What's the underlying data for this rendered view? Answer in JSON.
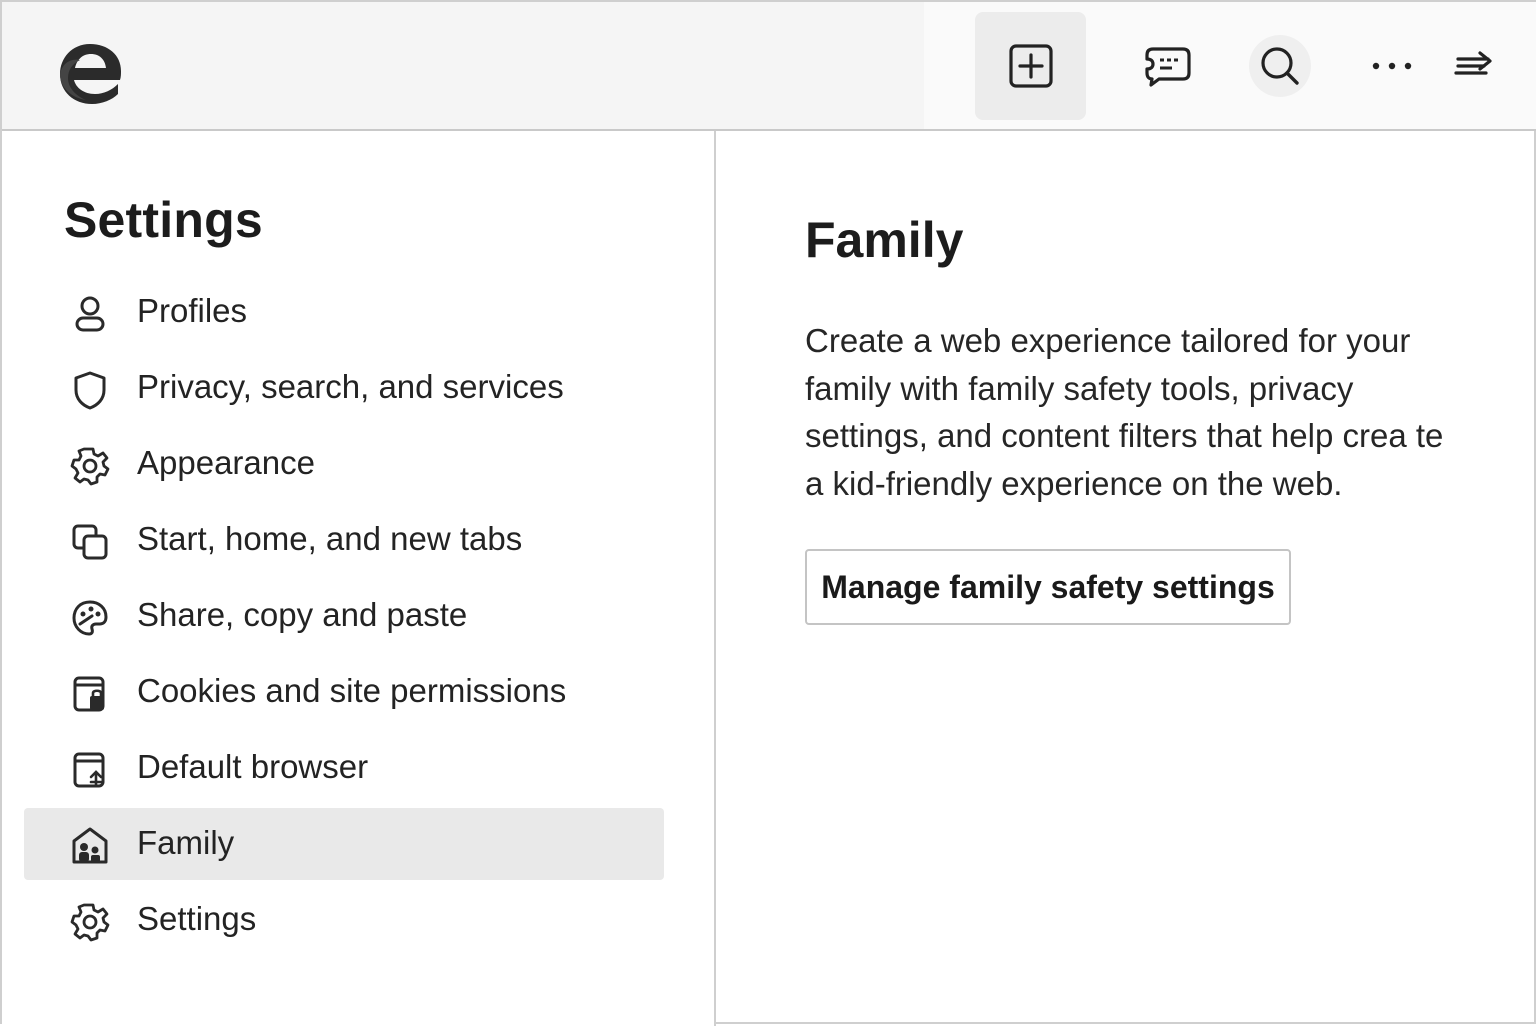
{
  "toolbar": {
    "buttons": [
      {
        "icon": "new-tab-icon"
      },
      {
        "icon": "feedback-icon"
      },
      {
        "icon": "search-icon"
      },
      {
        "icon": "more-icon"
      },
      {
        "icon": "send-icon"
      }
    ]
  },
  "sidebar": {
    "title": "Settings",
    "items": [
      {
        "label": "Profiles",
        "icon": "profile-icon"
      },
      {
        "label": "Privacy, search, and services",
        "icon": "shield-icon"
      },
      {
        "label": "Appearance",
        "icon": "gear-icon"
      },
      {
        "label": "Start, home, and new tabs",
        "icon": "tabs-icon"
      },
      {
        "label": "Share, copy and paste",
        "icon": "palette-icon"
      },
      {
        "label": "Cookies and site permissions",
        "icon": "cookies-icon"
      },
      {
        "label": "Default browser",
        "icon": "default-browser-icon"
      },
      {
        "label": "Family",
        "icon": "family-icon",
        "selected": true
      },
      {
        "label": "Settings",
        "icon": "gear-icon"
      }
    ]
  },
  "main": {
    "title": "Family",
    "description": "Create a web experience tailored for your family with family safety tools, privacy settings, and content filters that help crea te a kid-friendly experience on the web.",
    "button_label": "Manage family safety settings"
  },
  "colors": {
    "toolbar_bg": "#f5f5f5",
    "selected_bg": "#e9e9e9",
    "border": "#cfcfcf"
  }
}
